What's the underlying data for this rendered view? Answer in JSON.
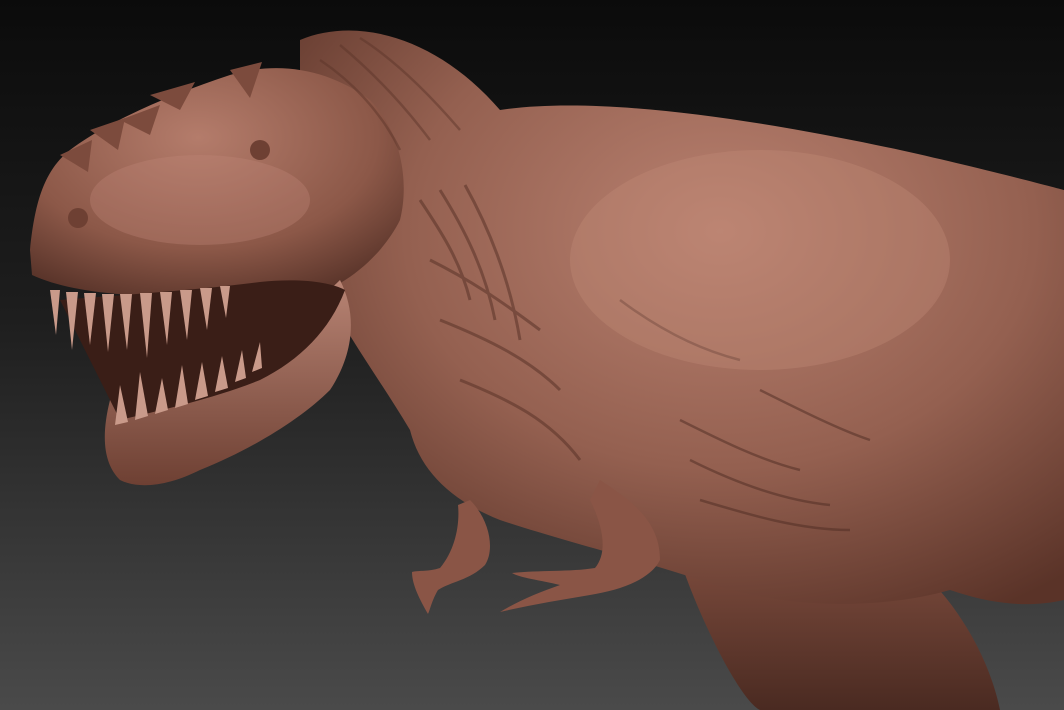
{
  "scene": {
    "subject": "dinosaur-sculpt",
    "colors": {
      "background_top": "#0b0b0b",
      "background_bottom": "#4a4a4a",
      "clay_light": "#b98170",
      "clay_mid": "#8e5a4b",
      "clay_dark": "#4e2c23",
      "teeth": "#c99a8a"
    }
  }
}
